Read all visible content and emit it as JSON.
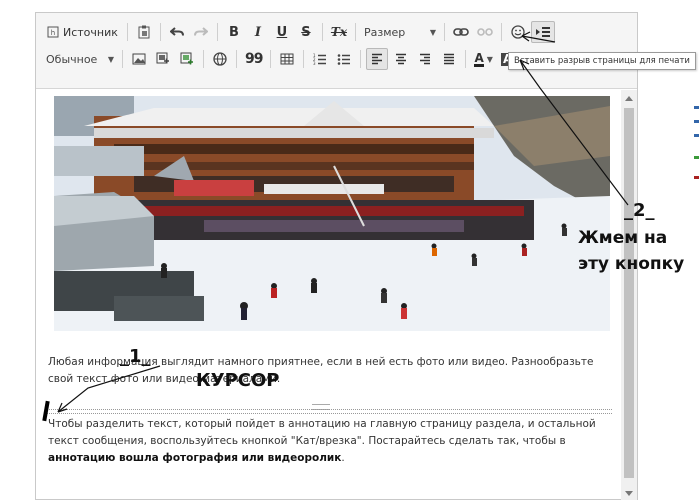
{
  "toolbar": {
    "row1": {
      "source_label": "Источник",
      "format_size": "Размер"
    },
    "row2": {
      "format_style": "Обычное"
    },
    "tooltip": "Вставить разрыв страницы для печати"
  },
  "icons": {
    "source": "source-icon",
    "paste": "paste-icon",
    "undo": "undo-icon",
    "redo": "redo-icon",
    "bold": "B",
    "italic": "I",
    "underline": "U",
    "strike": "S",
    "clear_format": "Tx",
    "link": "link-icon",
    "unlink": "unlink-icon",
    "smiley": "smiley-icon",
    "pagebreak": "pagebreak-icon",
    "image": "image-icon",
    "globe": "globe-icon",
    "quote": "99",
    "table": "table-icon",
    "text_color": "A",
    "bg_color": "A"
  },
  "content": {
    "para1": "Любая информация выглядит намного приятнее, если в ней есть фото или видео. Разнообразьте свой текст фото или видео материалами.",
    "para2_start": "Чтобы разделить текст, который пойдет в аннотацию на главную страницу раздела, и остальной текст сообщения, воспользуйтесь кнопкой \"Кат/врезка\". Постарайтесь сделать так, чтобы в ",
    "para2_bold": "аннотацию вошла фотография или видеоролик",
    "para2_end": "."
  },
  "annotations": {
    "step1": "_1_",
    "cursor": "КУРСОР",
    "step2": "_2_",
    "hint_line1": "Жмем на",
    "hint_line2": "эту кнопку"
  },
  "colors": {
    "toolbar_bg": "#f5f5f5",
    "border": "#c9c9c9",
    "text": "#333333",
    "snow": "#e8edf2",
    "building_roof": "#f0f0f0",
    "building_wood": "#8a4a28"
  }
}
